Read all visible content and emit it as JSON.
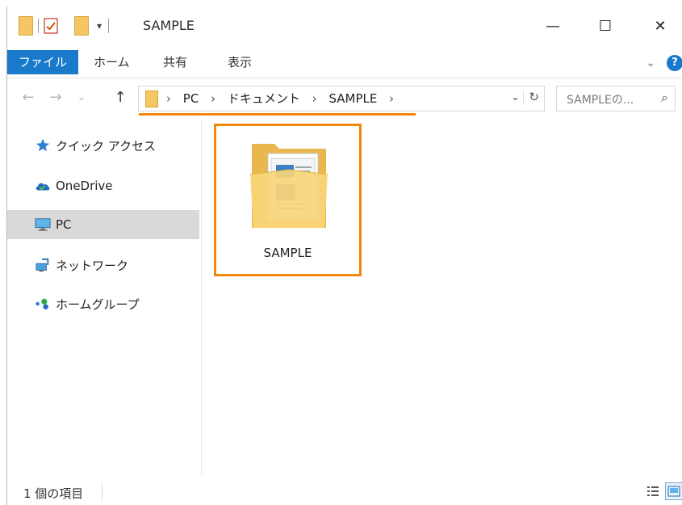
{
  "window": {
    "title": "SAMPLE",
    "controls": {
      "minimize": "—",
      "maximize": "☐",
      "close": "✕"
    }
  },
  "quick_access": {
    "dropdown_icon": "▾"
  },
  "ribbon": {
    "tabs": [
      "ファイル",
      "ホーム",
      "共有",
      "表示"
    ],
    "expand_icon": "⌄",
    "help_label": "?"
  },
  "nav": {
    "back": "←",
    "forward": "→",
    "recent": "⌄",
    "up": "↑",
    "breadcrumbs": [
      "PC",
      "ドキュメント",
      "SAMPLE"
    ],
    "separator": "›",
    "dropdown": "⌄",
    "refresh": "↻",
    "search_placeholder": "SAMPLEの...",
    "search_icon": "⌕"
  },
  "sidebar": {
    "items": [
      {
        "label": "クイック アクセス",
        "icon": "star-icon"
      },
      {
        "label": "OneDrive",
        "icon": "cloud-icon"
      },
      {
        "label": "PC",
        "icon": "monitor-icon",
        "selected": true
      },
      {
        "label": "ネットワーク",
        "icon": "network-icon"
      },
      {
        "label": "ホームグループ",
        "icon": "homegroup-icon"
      }
    ]
  },
  "content": {
    "items": [
      {
        "name": "SAMPLE",
        "type": "folder",
        "selected": true
      }
    ]
  },
  "status": {
    "text": "1 個の項目"
  },
  "colors": {
    "accent": "#1979ca",
    "highlight": "#f3860d",
    "folder": "#f4c764",
    "selection": "#d9d9d9"
  }
}
